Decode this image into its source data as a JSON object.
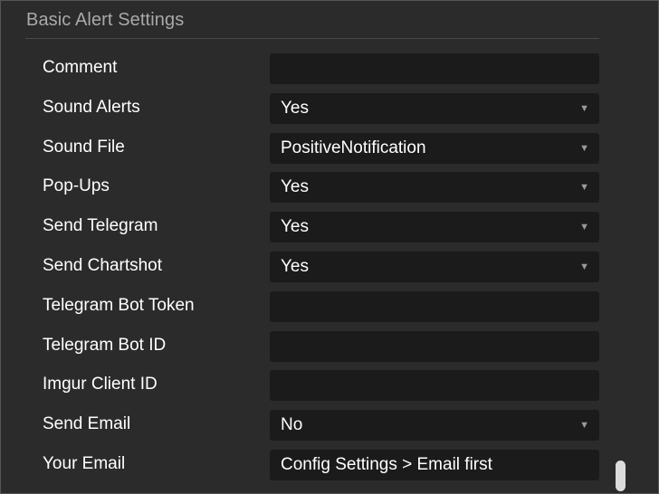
{
  "section": {
    "title": "Basic Alert Settings"
  },
  "fields": {
    "comment": {
      "label": "Comment",
      "value": ""
    },
    "sound_alerts": {
      "label": "Sound Alerts",
      "value": "Yes"
    },
    "sound_file": {
      "label": "Sound File",
      "value": "PositiveNotification"
    },
    "pop_ups": {
      "label": "Pop-Ups",
      "value": "Yes"
    },
    "send_telegram": {
      "label": "Send Telegram",
      "value": "Yes"
    },
    "send_chartshot": {
      "label": "Send Chartshot",
      "value": "Yes"
    },
    "telegram_bot_token": {
      "label": "Telegram Bot Token",
      "value": ""
    },
    "telegram_bot_id": {
      "label": "Telegram Bot ID",
      "value": ""
    },
    "imgur_client_id": {
      "label": "Imgur Client ID",
      "value": ""
    },
    "send_email": {
      "label": "Send Email",
      "value": "No"
    },
    "your_email": {
      "label": "Your Email",
      "value": "Config Settings > Email first"
    }
  },
  "icons": {
    "dropdown": "caret-down-icon",
    "dropdown_glyph": "▼"
  },
  "colors": {
    "panel_background": "#2b2b2b",
    "field_background": "#1b1b1b",
    "label_text": "#ffffff",
    "section_title": "#a9a9a9",
    "scrollbar_thumb": "#dcdcdc"
  }
}
